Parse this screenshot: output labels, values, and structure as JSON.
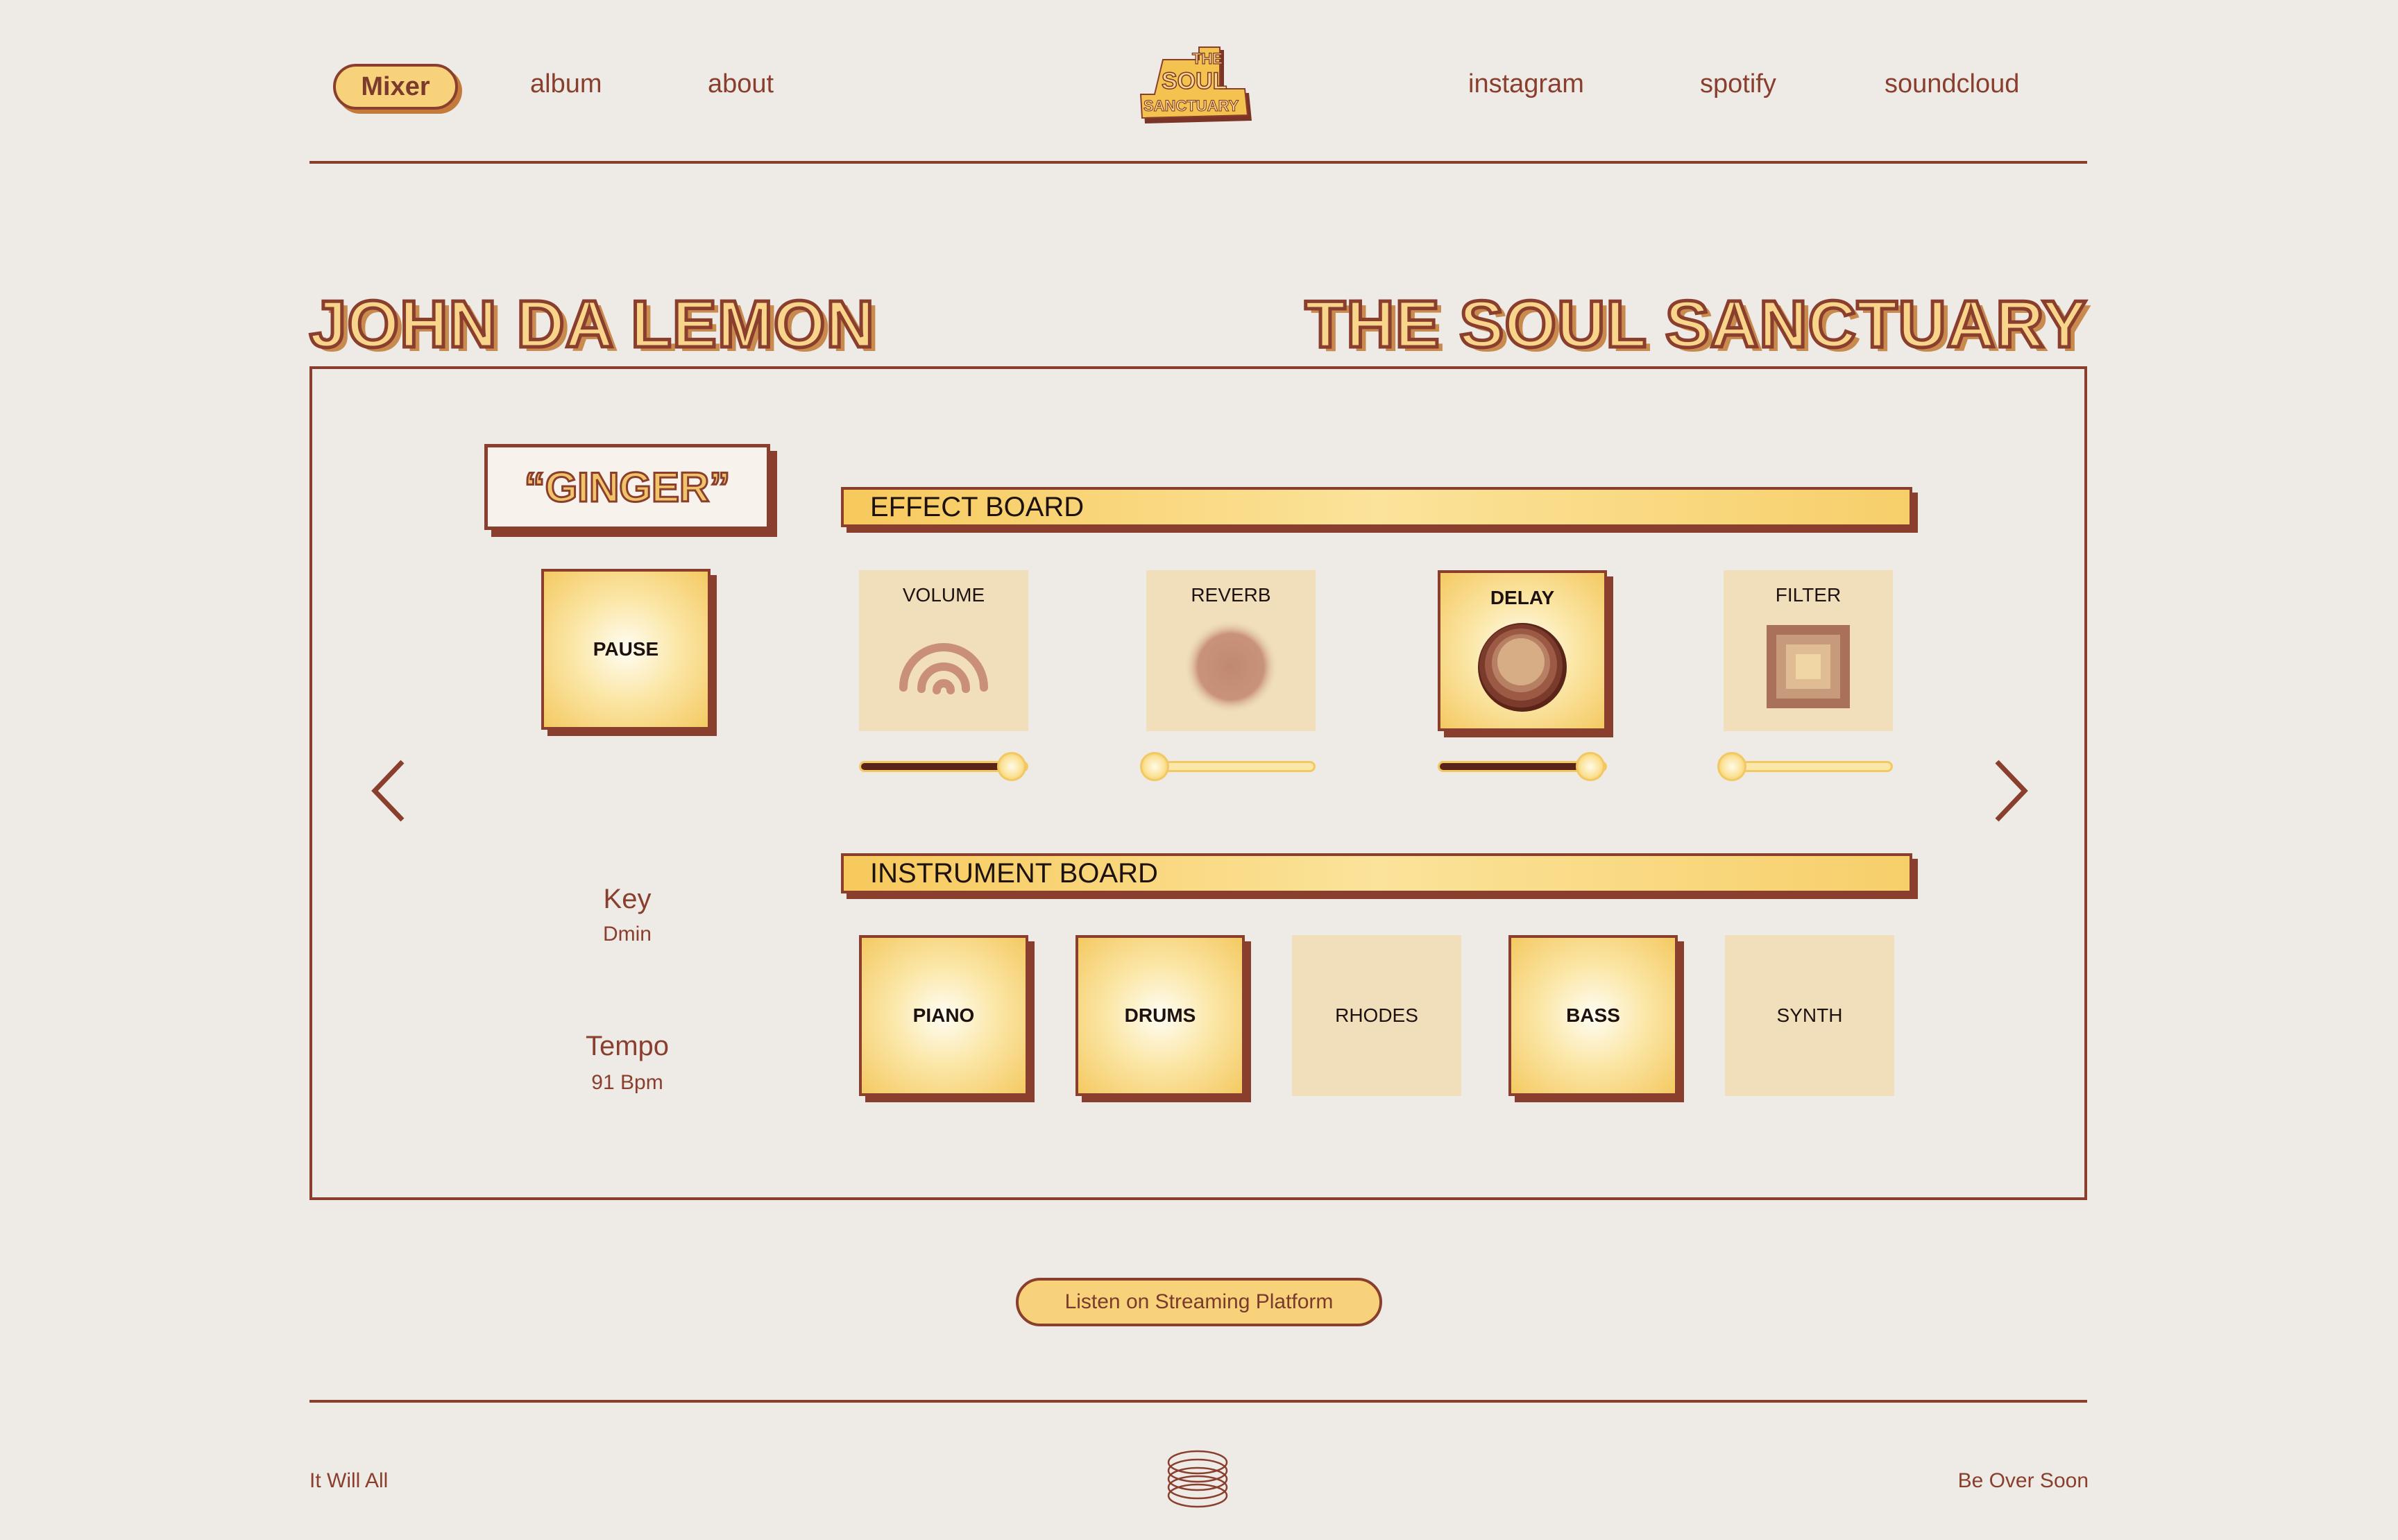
{
  "nav": {
    "active": "Mixer",
    "left_links": [
      "album",
      "about"
    ],
    "right_links": [
      "instagram",
      "spotify",
      "soundcloud"
    ]
  },
  "logo": {
    "line1": "THE",
    "line2": "SOUL",
    "line3": "SANCTUARY"
  },
  "artist": "JOHN DA LEMON",
  "album": "THE SOUL SANCTUARY",
  "song": {
    "title": "“GINGER”",
    "play_state": "PAUSE"
  },
  "info": {
    "key_label": "Key",
    "key_value": "Dmin",
    "tempo_label": "Tempo",
    "tempo_value": "91 Bpm"
  },
  "effect_board": {
    "title": "EFFECT BOARD",
    "effects": [
      {
        "label": "VOLUME",
        "icon": "volume-waves-icon",
        "active": false,
        "level": 0.9
      },
      {
        "label": "REVERB",
        "icon": "reverb-blur-icon",
        "active": false,
        "level": 0.05
      },
      {
        "label": "DELAY",
        "icon": "delay-rings-icon",
        "active": true,
        "level": 0.9
      },
      {
        "label": "FILTER",
        "icon": "filter-squares-icon",
        "active": false,
        "level": 0.05
      }
    ]
  },
  "instrument_board": {
    "title": "INSTRUMENT BOARD",
    "instruments": [
      {
        "label": "PIANO",
        "active": true
      },
      {
        "label": "DRUMS",
        "active": true
      },
      {
        "label": "RHODES",
        "active": false
      },
      {
        "label": "BASS",
        "active": true
      },
      {
        "label": "SYNTH",
        "active": false
      }
    ]
  },
  "cta": "Listen on Streaming Platform",
  "footer": {
    "left": "It Will All",
    "right": "Be Over Soon",
    "icon": "vinyl-coil-icon"
  },
  "colors": {
    "brown": "#8a3f2e",
    "yellow": "#f7d27a",
    "paper": "#eeebe6",
    "tile_off": "#f0dfba"
  }
}
